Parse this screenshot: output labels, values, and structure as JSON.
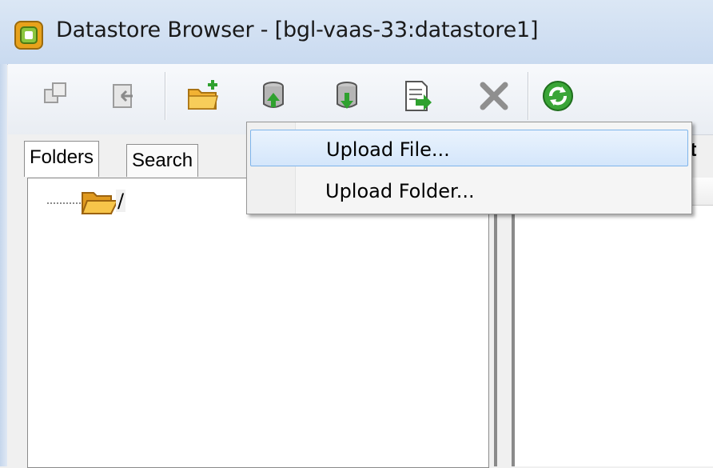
{
  "window": {
    "title": "Datastore Browser - [bgl-vaas-33:datastore1]",
    "app_icon": "vsphere-app-icon"
  },
  "toolbar": {
    "buttons": [
      {
        "icon": "copy-icon",
        "enabled": false
      },
      {
        "icon": "back-icon",
        "enabled": false
      },
      {
        "icon": "new-folder-icon",
        "enabled": true
      },
      {
        "icon": "upload-datastore-icon",
        "enabled": true
      },
      {
        "icon": "download-datastore-icon",
        "enabled": true
      },
      {
        "icon": "register-vm-icon",
        "enabled": true
      },
      {
        "icon": "delete-icon",
        "enabled": false
      },
      {
        "icon": "refresh-icon",
        "enabled": true
      }
    ]
  },
  "tabs": [
    {
      "label": "Folders",
      "active": true
    },
    {
      "label": "Search",
      "active": false
    }
  ],
  "folder_tree": {
    "root_label": "/"
  },
  "right_panel": {
    "header_partial": "at"
  },
  "upload_menu": {
    "items": [
      {
        "label": "Upload File...",
        "highlighted": true
      },
      {
        "label": "Upload Folder...",
        "highlighted": false
      }
    ]
  },
  "colors": {
    "titlebar": "#c9daf0",
    "menu_highlight_border": "#7eb4ea",
    "folder": "#f2b233",
    "refresh_green": "#3aa537"
  }
}
